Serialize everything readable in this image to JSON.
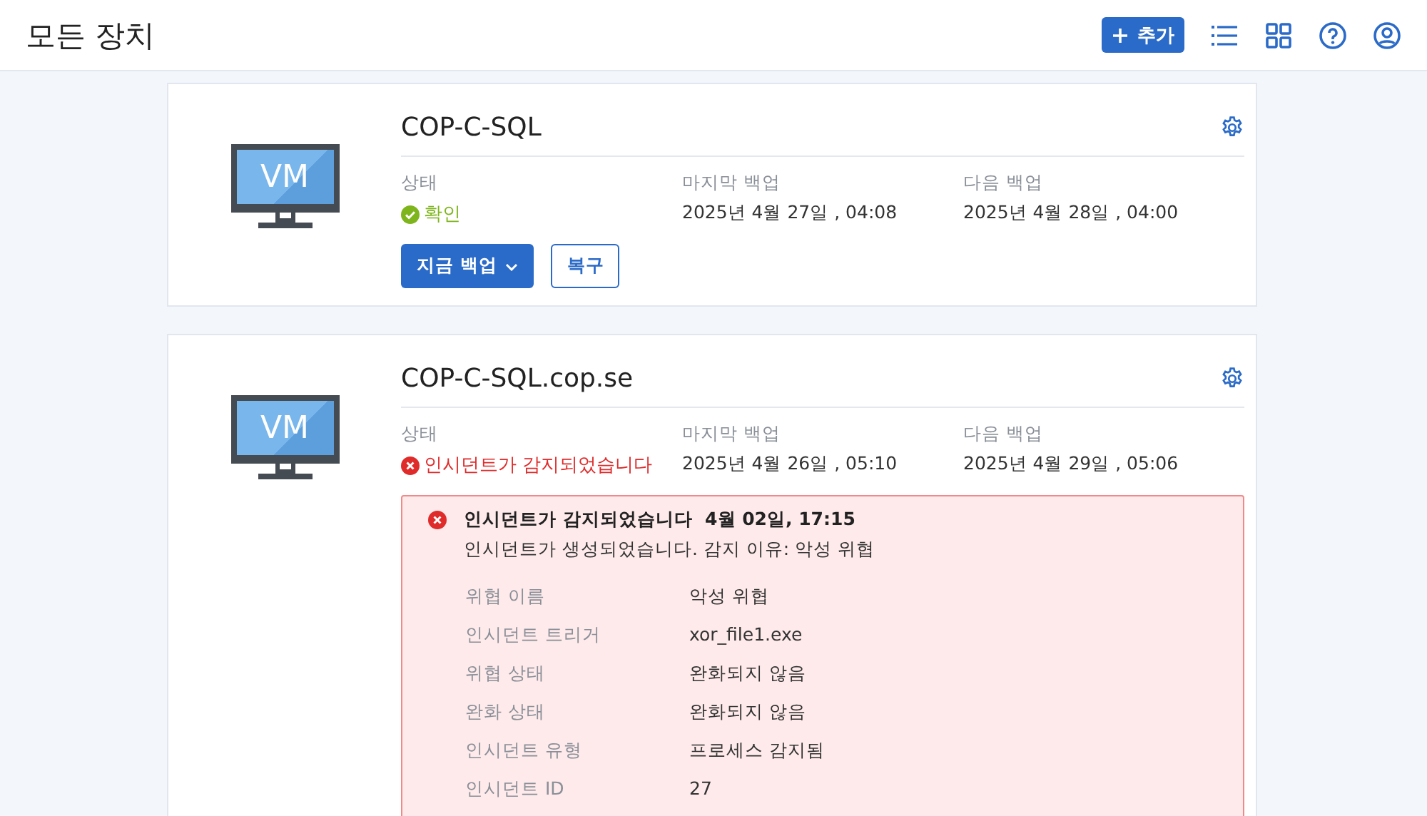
{
  "header": {
    "title": "모든 장치",
    "add_button": "추가"
  },
  "devices": [
    {
      "name": "COP-C-SQL",
      "icon_label": "VM",
      "status_label": "상태",
      "status": {
        "kind": "ok",
        "text": "확인"
      },
      "last_backup_label": "마지막 백업",
      "last_backup": "2025년 4월 27일 , 04:08",
      "next_backup_label": "다음 백업",
      "next_backup": "2025년 4월 28일 , 04:00",
      "buttons": {
        "backup": "지금 백업",
        "restore": "복구"
      }
    },
    {
      "name": "COP-C-SQL.cop.se",
      "icon_label": "VM",
      "status_label": "상태",
      "status": {
        "kind": "incident",
        "text": "인시던트가 감지되었습니다"
      },
      "last_backup_label": "마지막 백업",
      "last_backup": "2025년 4월 26일 , 05:10",
      "next_backup_label": "다음 백업",
      "next_backup": "2025년 4월 29일 , 05:06",
      "alert": {
        "title": "인시던트가 감지되었습니다",
        "time": "4월 02일, 17:15",
        "message": "인시던트가 생성되었습니다. 감지 이유: 악성 위협",
        "details": [
          {
            "label": "위협 이름",
            "value": "악성 위협"
          },
          {
            "label": "인시던트 트리거",
            "value": "xor_file1.exe"
          },
          {
            "label": "위협 상태",
            "value": "완화되지 않음"
          },
          {
            "label": "완화 상태",
            "value": "완화되지 않음"
          },
          {
            "label": "인시던트 유형",
            "value": "프로세스 감지됨"
          },
          {
            "label": "인시던트 ID",
            "value": "27"
          }
        ]
      }
    }
  ]
}
